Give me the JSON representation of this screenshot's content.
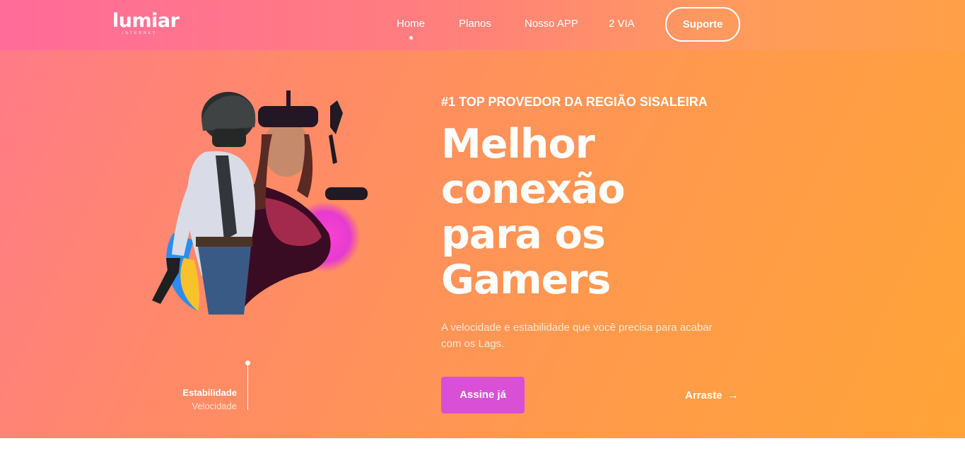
{
  "brand": {
    "name": "lumiar",
    "tagline": "INTERNET"
  },
  "nav": {
    "items": [
      {
        "label": "Home",
        "active": true
      },
      {
        "label": "Planos"
      },
      {
        "label": "Nosso APP"
      },
      {
        "label": "2 VIA"
      }
    ],
    "support_label": "Suporte"
  },
  "hero": {
    "eyebrow": "#1 TOP PROVEDOR DA REGIÃO SISALEIRA",
    "headline_lines": [
      "Melhor",
      "conexão",
      "para os",
      "Gamers"
    ],
    "subtitle": "A velocidade e estabilidade que você precisa para acabar com os Lags.",
    "cta_label": "Assine já",
    "swipe_label": "Arraste",
    "features": [
      "Estabilidade",
      "Velocidade"
    ]
  },
  "colors": {
    "cta": "#d94fd6",
    "hero_gradient_start": "#ff7a8a",
    "hero_gradient_end": "#ffa437",
    "header_start": "#ff6b9a"
  },
  "icons": [
    "arrow-right-icon"
  ]
}
